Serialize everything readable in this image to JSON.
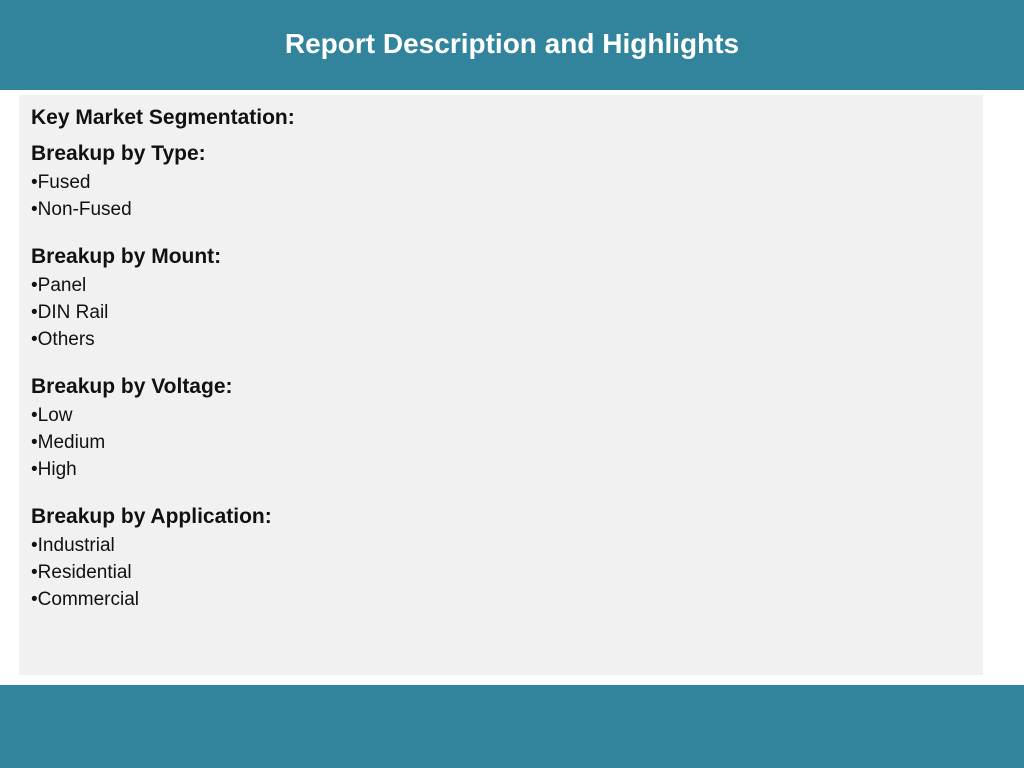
{
  "header": {
    "title": "Report Description and Highlights"
  },
  "content": {
    "segmentation_title": "Key Market Segmentation:",
    "groups": [
      {
        "title": "Breakup by Type:",
        "items": [
          "•Fused",
          "•Non-Fused"
        ]
      },
      {
        "title": "Breakup by Mount:",
        "items": [
          "•Panel",
          "•DIN Rail",
          "•Others"
        ]
      },
      {
        "title": "Breakup by Voltage:",
        "items": [
          "•Low",
          "•Medium",
          "•High"
        ]
      },
      {
        "title": "Breakup by Application:",
        "items": [
          "•Industrial",
          "•Residential",
          "•Commercial"
        ]
      }
    ]
  },
  "colors": {
    "band": "#31849b",
    "panel": "#f1f1f1",
    "text": "#111111"
  }
}
